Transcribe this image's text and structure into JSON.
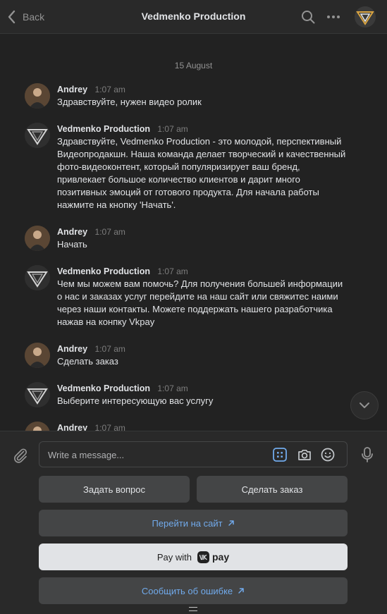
{
  "header": {
    "back_label": "Back",
    "title": "Vedmenko Production",
    "icons": [
      "search-icon",
      "more-icon",
      "community-avatar"
    ]
  },
  "chat": {
    "date": "15 August",
    "messages": [
      {
        "author": "Andrey",
        "time": "1:07 am",
        "text": "Здравствуйте, нужен видео ролик",
        "avatar": "user"
      },
      {
        "author": "Vedmenko Production",
        "time": "1:07 am",
        "text": "Здравствуйте, Vedmenko Production - это молодой, перспективный Видеопродакшн. Наша команда делает творческий и качественный фото-видеоконтент, который популяризирует ваш бренд, привлекает большое количество клиентов и дарит много позитивных эмоций от готового продукта. Для начала работы нажмите на кнопку 'Начать'.",
        "avatar": "bot"
      },
      {
        "author": "Andrey",
        "time": "1:07 am",
        "text": "Начать",
        "avatar": "user"
      },
      {
        "author": "Vedmenko Production",
        "time": "1:07 am",
        "text": "Чем мы можем вам помочь? Для получения большей информации о нас и заказах услуг перейдите на наш сайт или свяжитес наими через наши контакты. Можете поддержать нашего разработчика нажав на конпку Vkpay",
        "avatar": "bot"
      },
      {
        "author": "Andrey",
        "time": "1:07 am",
        "text": "Сделать заказ",
        "avatar": "user"
      },
      {
        "author": "Vedmenko Production",
        "time": "1:07 am",
        "text": "Выберите интересующую вас услугу",
        "avatar": "bot"
      },
      {
        "author": "Andrey",
        "time": "1:07 am",
        "text": "",
        "avatar": "user"
      }
    ]
  },
  "composer": {
    "placeholder": "Write a message...",
    "icons": [
      "attach-icon",
      "keyboard-icon",
      "camera-icon",
      "emoji-icon",
      "microphone-icon"
    ]
  },
  "keyboard": {
    "ask_question": "Задать вопрос",
    "make_order": "Сделать заказ",
    "go_to_site": "Перейти на сайт",
    "pay_with": "Pay with",
    "pay_word": "pay",
    "report_error": "Сообщить об ошибке"
  },
  "colors": {
    "background": "#222222",
    "header": "#292929",
    "button": "#444546",
    "link": "#71aaeb",
    "light_button": "#e1e3e6"
  }
}
